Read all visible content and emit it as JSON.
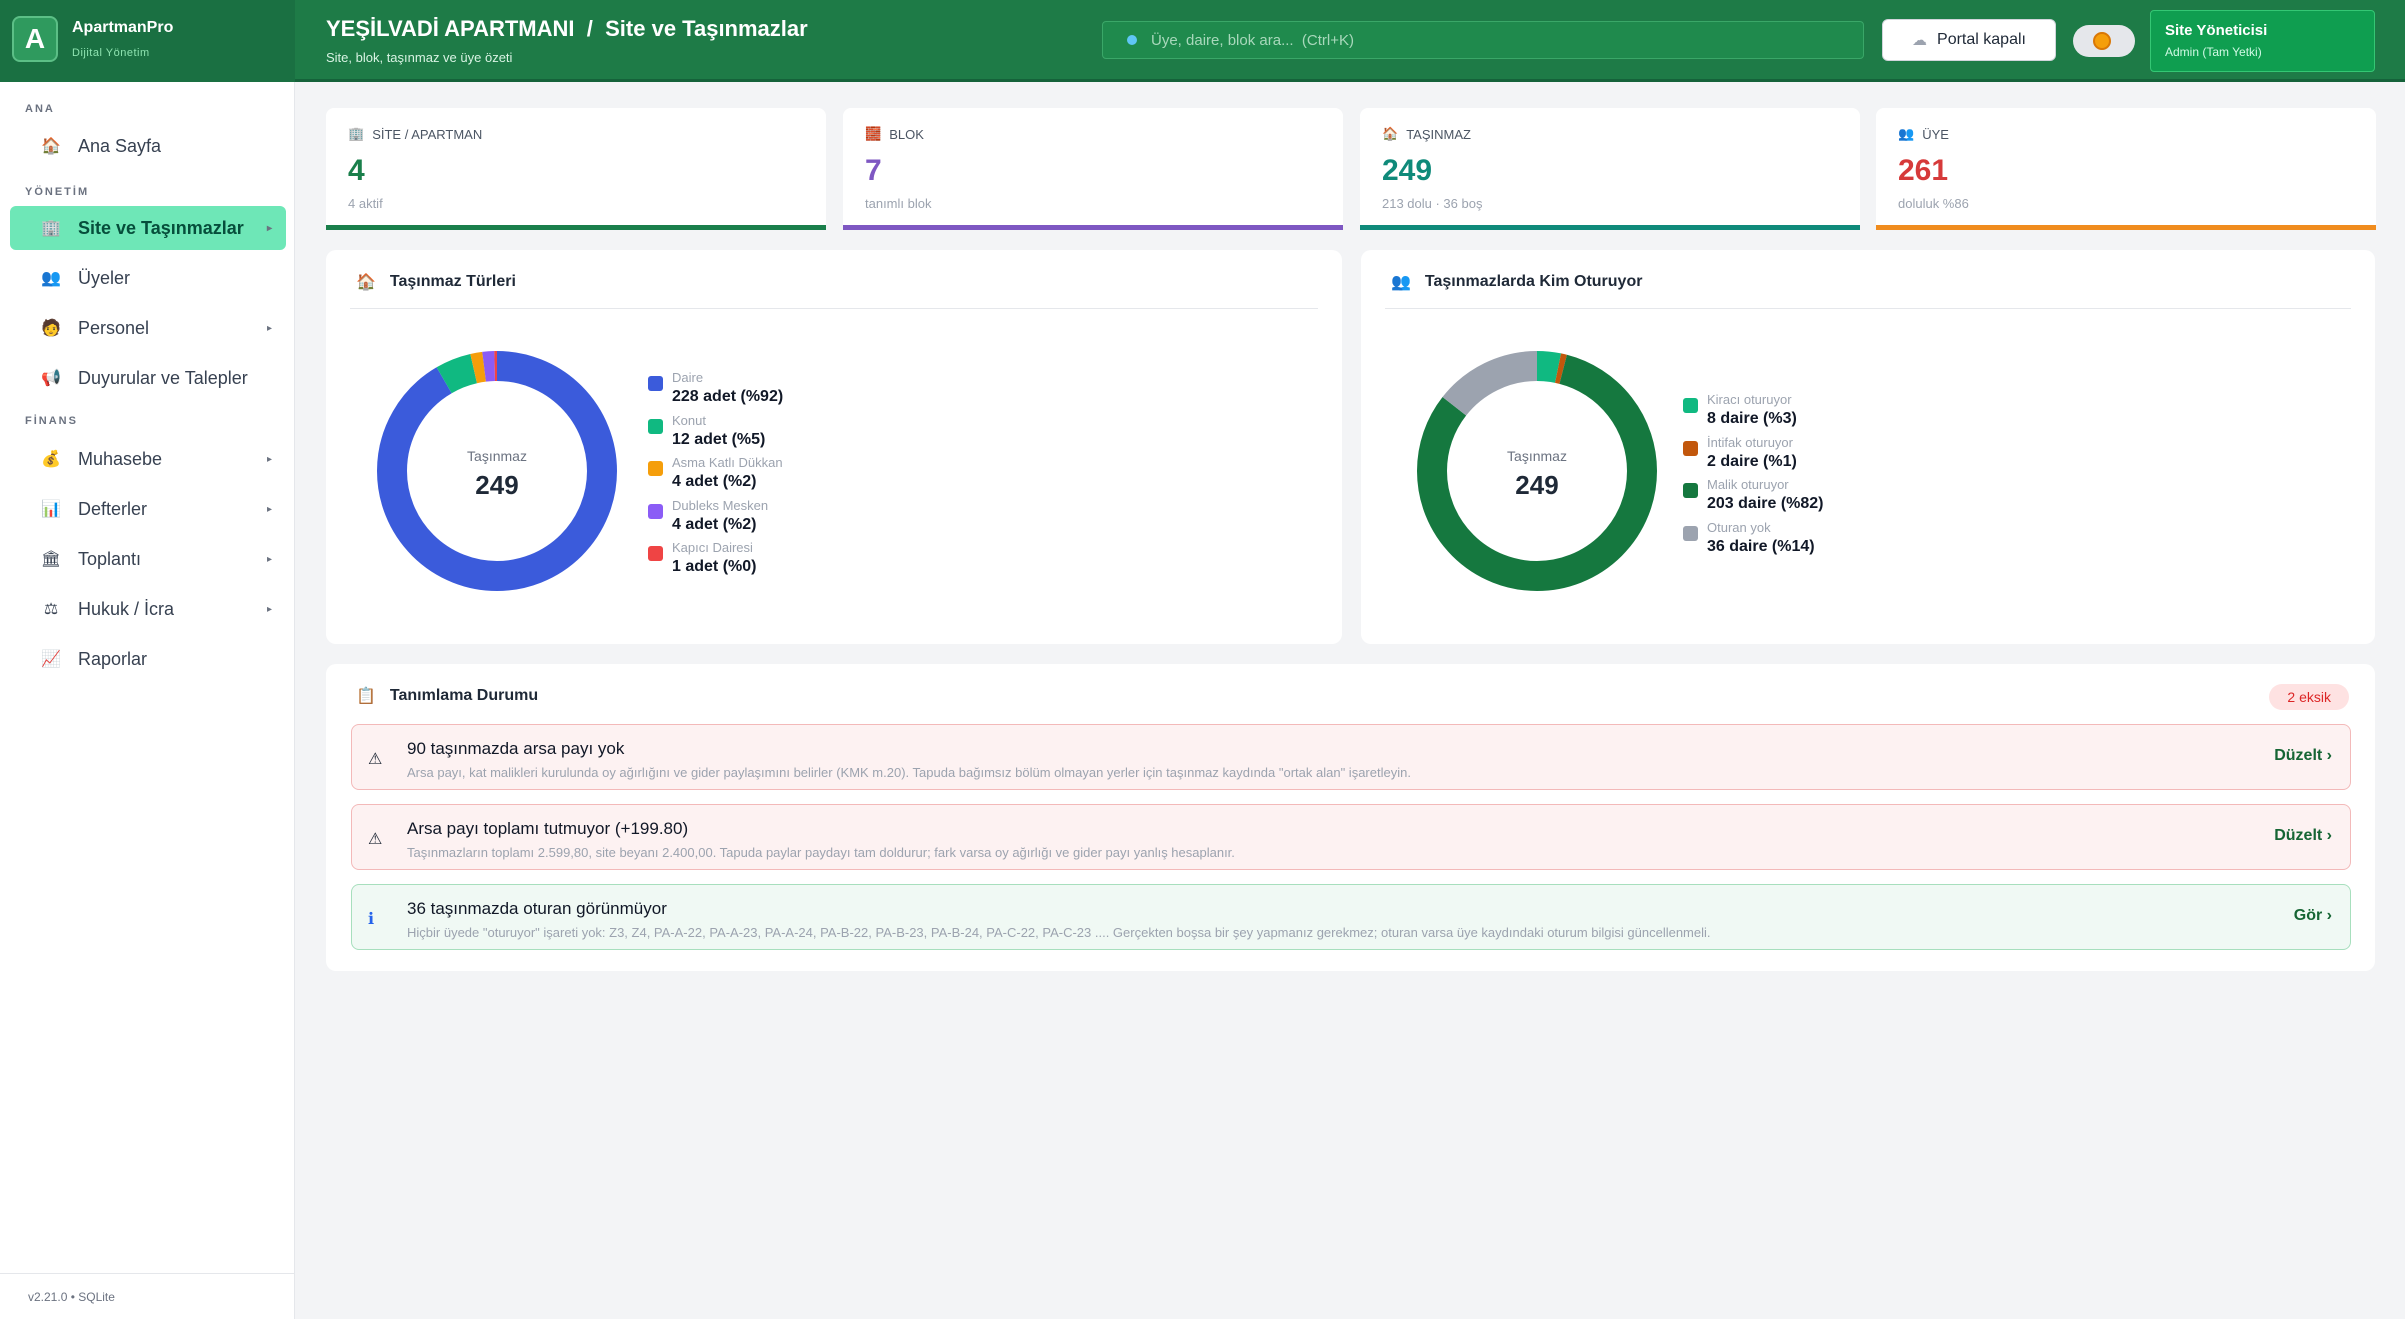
{
  "brand": {
    "logo_letter": "A",
    "name": "ApartmanPro",
    "subtitle": "Dijital Yönetim"
  },
  "header": {
    "site_name": "YEŞİLVADİ APARTMANI",
    "separator": "/",
    "page": "Site ve Taşınmazlar",
    "subtitle": "Site, blok, taşınmaz ve üye özeti",
    "search_placeholder": "Üye, daire, blok ara...  (Ctrl+K)",
    "portal_button": "Portal kapalı",
    "user_name": "Site Yöneticisi",
    "user_role": "Admin (Tam Yetki)"
  },
  "sidebar": {
    "sections": [
      "ANA",
      "YÖNETİM",
      "FİNANS"
    ],
    "items": [
      {
        "label": "Ana Sayfa",
        "icon": "🏠"
      },
      {
        "label": "Site ve Taşınmazlar",
        "icon": "🏢"
      },
      {
        "label": "Üyeler",
        "icon": "👥"
      },
      {
        "label": "Personel",
        "icon": "🧑"
      },
      {
        "label": "Duyurular ve Talepler",
        "icon": "📢"
      },
      {
        "label": "Muhasebe",
        "icon": "💰"
      },
      {
        "label": "Defterler",
        "icon": "📊"
      },
      {
        "label": "Toplantı",
        "icon": "🏛"
      },
      {
        "label": "Hukuk / İcra",
        "icon": "⚖"
      },
      {
        "label": "Raporlar",
        "icon": "📈"
      }
    ],
    "footer": "v2.21.0  •  SQLite"
  },
  "stats": [
    {
      "label": "SİTE / APARTMAN",
      "value": "4",
      "sub": "4 aktif",
      "color": "#1a7f4b",
      "icon": "🏢"
    },
    {
      "label": "BLOK",
      "value": "7",
      "sub": "tanımlı blok",
      "color": "#7e57c2",
      "icon": "🧱"
    },
    {
      "label": "TAŞINMAZ",
      "value": "249",
      "sub": "213 dolu · 36 boş",
      "color": "#0f8a7a",
      "icon": "🏠"
    },
    {
      "label": "ÜYE",
      "value": "261",
      "sub": "doluluk %86",
      "color": "#d63a3a",
      "bar": "#f08c1e",
      "icon": "👥"
    }
  ],
  "types_panel": {
    "title": "Taşınmaz Türleri",
    "center_label": "Taşınmaz",
    "center_value": "249",
    "legend": [
      {
        "name": "Daire",
        "value": "228 adet  (%92)"
      },
      {
        "name": "Konut",
        "value": "12 adet  (%5)"
      },
      {
        "name": "Asma Katlı Dükkan",
        "value": "4 adet  (%2)"
      },
      {
        "name": "Dubleks Mesken",
        "value": "4 adet  (%2)"
      },
      {
        "name": "Kapıcı Dairesi",
        "value": "1 adet  (%0)"
      }
    ]
  },
  "occupancy_panel": {
    "title": "Taşınmazlarda Kim Oturuyor",
    "center_label": "Taşınmaz",
    "center_value": "249",
    "legend": [
      {
        "name": "Kiracı oturuyor",
        "value": "8 daire  (%3)"
      },
      {
        "name": "İntifak oturuyor",
        "value": "2 daire  (%1)"
      },
      {
        "name": "Malik oturuyor",
        "value": "203 daire  (%82)"
      },
      {
        "name": "Oturan yok",
        "value": "36 daire  (%14)"
      }
    ]
  },
  "chart_data": [
    {
      "type": "pie",
      "categories": [
        "Daire",
        "Konut",
        "Asma Katlı Dükkan",
        "Dubleks Mesken",
        "Kapıcı Dairesi"
      ],
      "values": [
        228,
        12,
        4,
        4,
        1
      ],
      "colors": [
        "#3b5bdb",
        "#10b981",
        "#f59e0b",
        "#8b5cf6",
        "#ef4444"
      ],
      "title": "Taşınmaz Türleri"
    },
    {
      "type": "pie",
      "categories": [
        "Kiracı oturuyor",
        "İntifak oturuyor",
        "Malik oturuyor",
        "Oturan yok"
      ],
      "values": [
        8,
        2,
        203,
        36
      ],
      "colors": [
        "#10b981",
        "#c2570c",
        "#15783f",
        "#9ca3af"
      ],
      "title": "Taşınmazlarda Kim Oturuyor"
    }
  ],
  "status_panel": {
    "title": "Tanımlama Durumu",
    "badge": "2 eksik",
    "alerts": [
      {
        "kind": "warn",
        "icon": "⚠",
        "title": "90 taşınmazda arsa payı yok",
        "desc": "Arsa payı, kat malikleri kurulunda oy ağırlığını ve gider paylaşımını belirler (KMK m.20). Tapuda bağımsız bölüm olmayan yerler için taşınmaz kaydında \"ortak alan\" işaretleyin.",
        "action": "Düzelt  ›"
      },
      {
        "kind": "warn",
        "icon": "⚠",
        "title": "Arsa payı toplamı tutmuyor (+199.80)",
        "desc": "Taşınmazların toplamı 2.599,80, site beyanı 2.400,00. Tapuda paylar paydayı tam doldurur; fark varsa oy ağırlığı ve gider payı yanlış hesaplanır.",
        "action": "Düzelt  ›"
      },
      {
        "kind": "info",
        "icon": "ℹ",
        "title": "36 taşınmazda oturan görünmüyor",
        "desc": "Hiçbir üyede \"oturuyor\" işareti yok: Z3, Z4, PA-A-22, PA-A-23, PA-A-24, PA-B-22, PA-B-23, PA-B-24, PA-C-22, PA-C-23 .... Gerçekten boşsa bir şey yapmanız gerekmez; oturan varsa üye kaydındaki oturum bilgisi güncellenmeli.",
        "action": "Gör  ›"
      }
    ]
  }
}
